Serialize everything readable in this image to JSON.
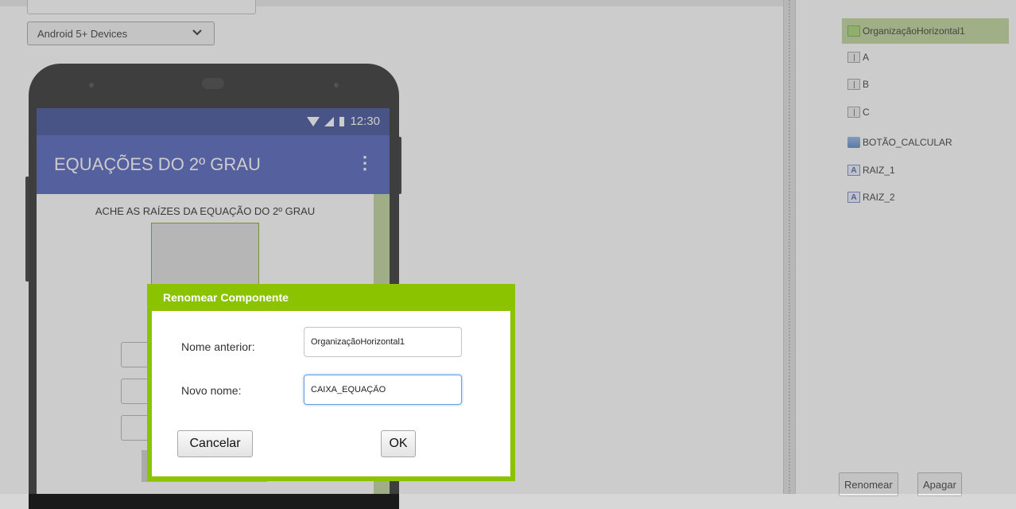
{
  "toolbar": {
    "device_select": "Android 5+ Devices"
  },
  "phone": {
    "status_time": "12:30",
    "app_title": "EQUAÇÕES DO 2º GRAU",
    "overflow_icon": "more-vertical-icon",
    "screen_label": "ACHE AS RAÍZES DA EQUAÇÃO DO 2º GRAU"
  },
  "components": {
    "items": [
      {
        "label": "OrganizaçãoHorizontal1",
        "icon": "horizontal-arrangement-icon",
        "selected": true
      },
      {
        "label": "A",
        "icon": "textbox-icon"
      },
      {
        "label": "B",
        "icon": "textbox-icon"
      },
      {
        "label": "C",
        "icon": "textbox-icon"
      },
      {
        "label": "BOTÃO_CALCULAR",
        "icon": "button-icon"
      },
      {
        "label": "RAIZ_1",
        "icon": "label-icon"
      },
      {
        "label": "RAIZ_2",
        "icon": "label-icon"
      }
    ],
    "rename_button": "Renomear",
    "delete_button": "Apagar"
  },
  "dialog": {
    "title": "Renomear Componente",
    "old_name_label": "Nome anterior:",
    "old_name_value": "OrganizaçãoHorizontal1",
    "new_name_label": "Novo nome:",
    "new_name_value": "CAIXA_EQUAÇÃO",
    "cancel_label": "Cancelar",
    "ok_label": "OK"
  },
  "colors": {
    "app_bar": "#3f51b5",
    "status_bar": "#2c3e8f",
    "dialog_frame": "#8cc300",
    "selection": "#b8d08e"
  }
}
